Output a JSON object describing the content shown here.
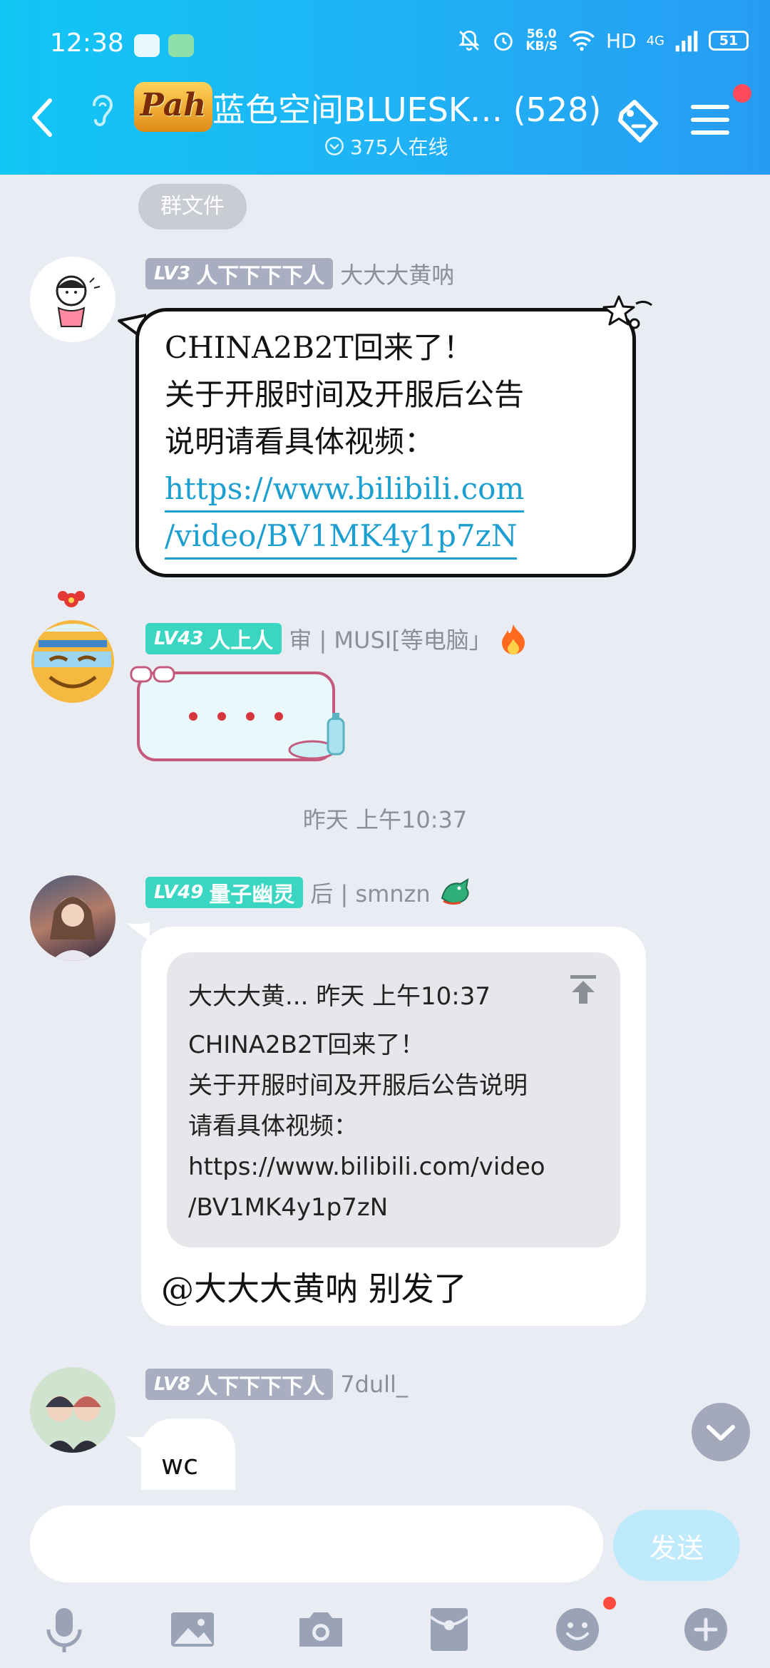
{
  "status_bar": {
    "time": "12:38",
    "net_speed_value": "56.0",
    "net_speed_unit": "KB/S",
    "hd": "HD",
    "network": "4G",
    "battery": "51"
  },
  "header": {
    "group_logo": "Pah",
    "group_title": "蓝色空间BLUESK… (528)",
    "online_count": "375人在线"
  },
  "chip_group_files": "群文件",
  "messages": [
    {
      "level": "LV3",
      "title": "人下下下下人",
      "sender": "大大大黄呐",
      "lines": [
        "CHINA2B2T回来了！",
        "关于开服时间及开服后公告",
        "说明请看具体视频："
      ],
      "link_lines": [
        "https://www.bilibili.com",
        "/video/BV1MK4y1p7zN"
      ]
    },
    {
      "level": "LV43",
      "title": "人上人",
      "sender": "审 | MUSI[等电脑」"
    },
    {
      "timestamp": "昨天 上午10:37"
    },
    {
      "level": "LV49",
      "title": "量子幽灵",
      "sender": "后 | smnzn",
      "quote_header": "大大大黄... 昨天 上午10:37",
      "quote_body": "CHINA2B2T回来了！\n关于开服时间及开服后公告说明\n请看具体视频：\nhttps://www.bilibili.com/video\n/BV1MK4y1p7zN",
      "reply": "@大大大黄呐 别发了"
    },
    {
      "level": "LV8",
      "title": "人下下下下人",
      "sender": "7dull_",
      "text": "wc"
    }
  ],
  "input": {
    "placeholder": "",
    "send_label": "发送"
  },
  "colors": {
    "header_start": "#11c6f4",
    "header_end": "#279cf3",
    "badge_gray": "#a8adbf",
    "badge_teal": "#3ad6c2",
    "link": "#1b9ed0",
    "background": "#e9ecf3"
  }
}
